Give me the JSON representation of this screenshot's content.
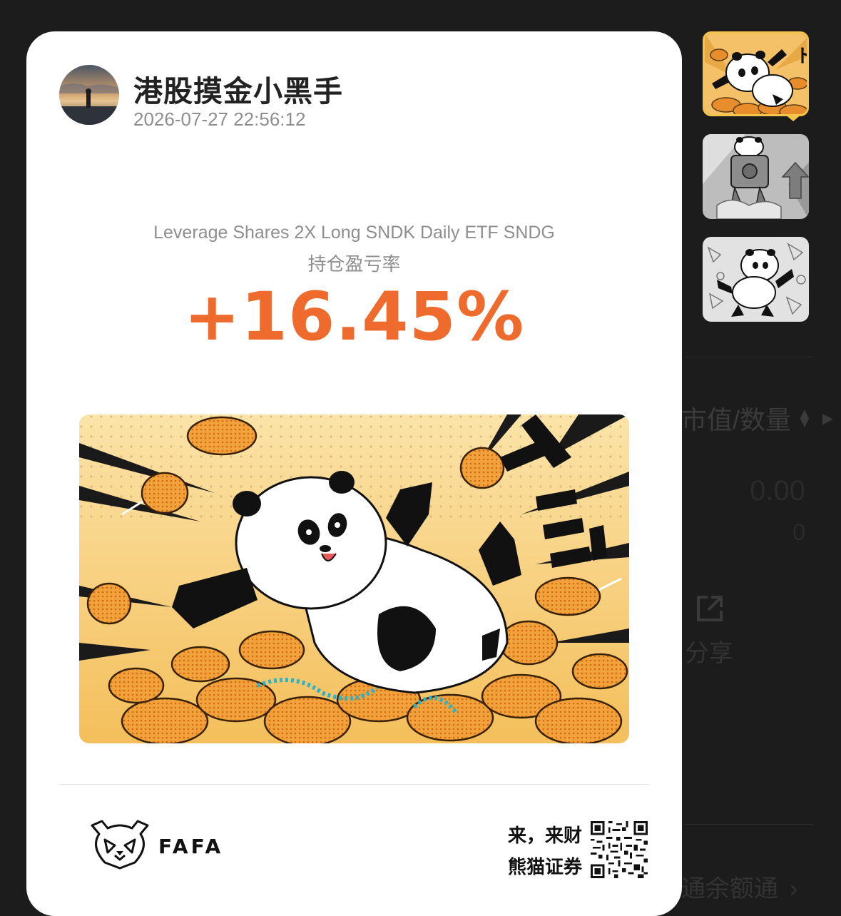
{
  "card": {
    "user": {
      "name": "港股摸金小黑手",
      "datetime": "2026-07-27 22:56:12"
    },
    "security": {
      "name": "Leverage Shares 2X Long SNDK Daily ETF SNDG",
      "metric_label": "持仓盈亏率",
      "value": "+16.45%"
    },
    "illustration": {
      "sfx": "ドン!!",
      "subject": "panda-on-coins"
    },
    "footer": {
      "brand": "FAFA",
      "slogan_line1": "来，来财",
      "slogan_line2": "熊猫证券"
    }
  },
  "background_panel": {
    "column_header": "市值/数量",
    "market_value": "0.00",
    "quantity": "0",
    "share_label": "分享",
    "quota_label": "通余额通"
  },
  "thumbnails": [
    {
      "name": "panda-coins",
      "selected": true
    },
    {
      "name": "panda-rocket",
      "selected": false
    },
    {
      "name": "panda-falling",
      "selected": false
    }
  ],
  "colors": {
    "accent": "#ef6a2d",
    "card_bg": "#ffffff",
    "page_bg": "#1c1c1c",
    "thumb_select": "#f5c54a"
  }
}
